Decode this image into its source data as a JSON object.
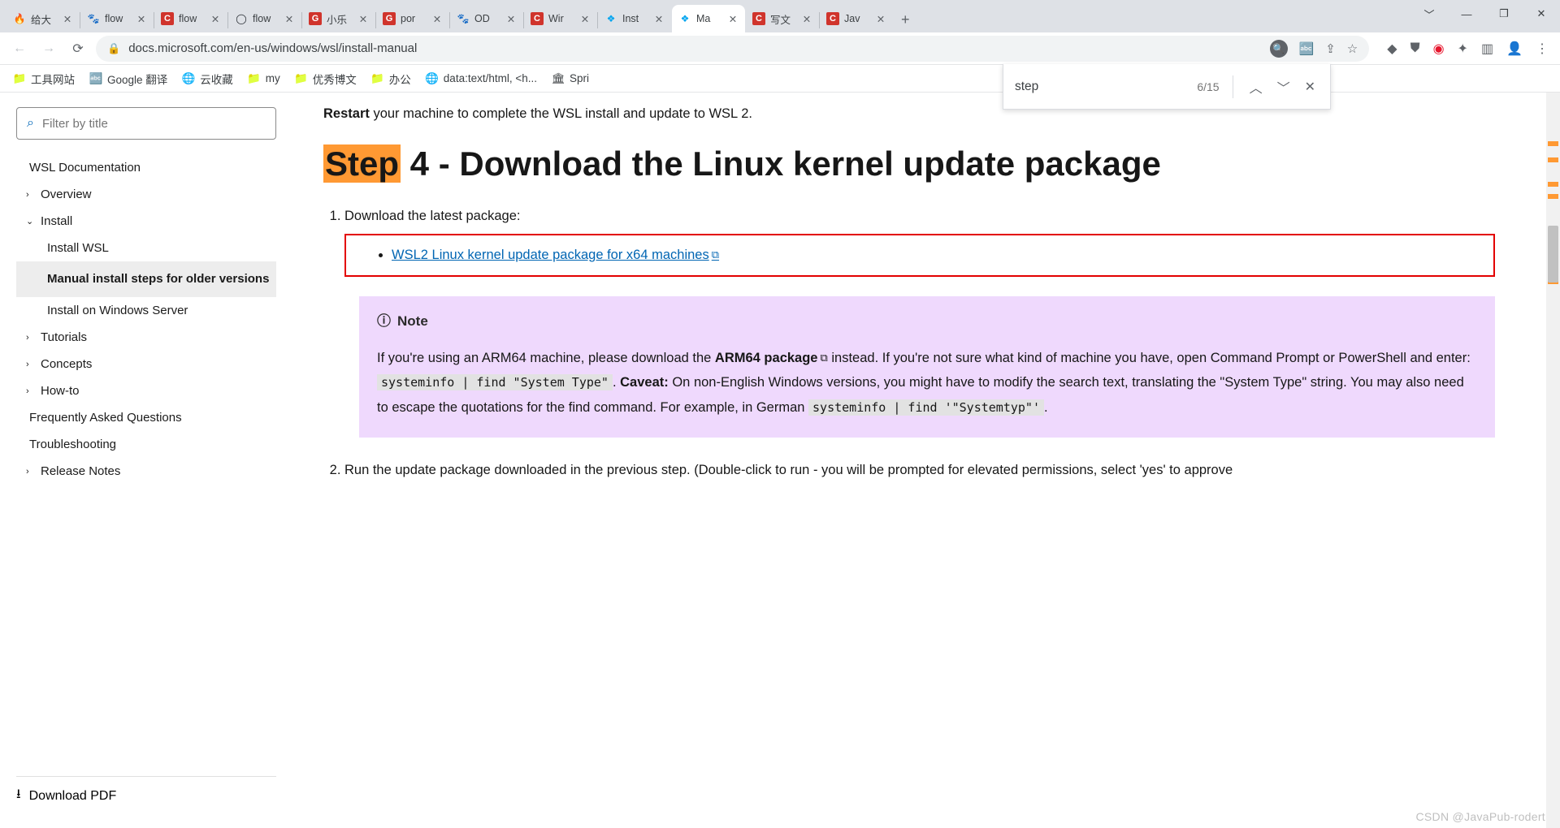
{
  "tabs": [
    {
      "title": "给大",
      "color": "#e24a1b",
      "glyph": "🔥"
    },
    {
      "title": "flow",
      "color": "#2b6cd4",
      "glyph": "🐾"
    },
    {
      "title": "flow",
      "color": "#d0342c",
      "glyph": "C",
      "bg": "#d0342c"
    },
    {
      "title": "flow",
      "color": "#24292f",
      "glyph": "◯"
    },
    {
      "title": "小乐",
      "color": "#d0342c",
      "glyph": "G",
      "bg": "#d0342c"
    },
    {
      "title": "por",
      "color": "#d0342c",
      "glyph": "G",
      "bg": "#d0342c"
    },
    {
      "title": "OD",
      "color": "#2b6cd4",
      "glyph": "🐾"
    },
    {
      "title": "Wir",
      "color": "#d0342c",
      "glyph": "C",
      "bg": "#d0342c"
    },
    {
      "title": "Inst",
      "color": "#00a4ef",
      "glyph": "❖"
    },
    {
      "title": "Ma",
      "color": "#00a4ef",
      "glyph": "❖",
      "active": true
    },
    {
      "title": "写文",
      "color": "#d0342c",
      "glyph": "C",
      "bg": "#d0342c"
    },
    {
      "title": "Jav",
      "color": "#d0342c",
      "glyph": "C",
      "bg": "#d0342c"
    }
  ],
  "url": "docs.microsoft.com/en-us/windows/wsl/install-manual",
  "bookmarks": [
    {
      "icon": "📁",
      "label": "工具网站"
    },
    {
      "icon": "🔤",
      "label": "Google 翻译"
    },
    {
      "icon": "🌐",
      "label": "云收藏"
    },
    {
      "icon": "📁",
      "label": "my"
    },
    {
      "icon": "📁",
      "label": "优秀博文"
    },
    {
      "icon": "📁",
      "label": "办公"
    },
    {
      "icon": "🌐",
      "label": "data:text/html, <h..."
    },
    {
      "icon": "🏛",
      "label": "Spri"
    }
  ],
  "find": {
    "query": "step",
    "count": "6/15"
  },
  "sidebar": {
    "filter_placeholder": "Filter by title",
    "items": {
      "doc_root": "WSL Documentation",
      "overview": "Overview",
      "install": "Install",
      "install_wsl": "Install WSL",
      "manual": "Manual install steps for older versions",
      "install_server": "Install on Windows Server",
      "tutorials": "Tutorials",
      "concepts": "Concepts",
      "howto": "How-to",
      "faq": "Frequently Asked Questions",
      "trouble": "Troubleshooting",
      "release": "Release Notes"
    },
    "download_pdf": "Download PDF"
  },
  "content": {
    "restart_b": "Restart",
    "restart_rest": " your machine to complete the WSL install and update to WSL 2.",
    "h2_mark": "Step",
    "h2_rest": " 4 - Download the Linux kernel update package",
    "li1": "Download the latest package:",
    "link1": "WSL2 Linux kernel update package for x64 machines",
    "note_label": "Note",
    "note_p1a": "If you're using an ARM64 machine, please download the ",
    "note_p1_b": "ARM64 package",
    "note_p1c": " instead. If you're not sure what kind of machine you have, open Command Prompt or PowerShell and enter: ",
    "note_code1": "systeminfo | find \"System Type\"",
    "note_p1d": ". ",
    "note_caveat": "Caveat:",
    "note_p1e": " On non-English Windows versions, you might have to modify the search text, translating the \"System Type\" string. You may also need to escape the quotations for the find command. For example, in German ",
    "note_code2": "systeminfo | find '\"Systemtyp\"'",
    "note_p1f": ".",
    "li2": "Run the update package downloaded in the previous step. (Double-click to run - you will be prompted for elevated permissions, select 'yes' to approve"
  },
  "watermark": "CSDN @JavaPub-rodert"
}
